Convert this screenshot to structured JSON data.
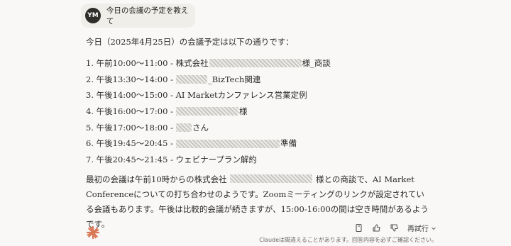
{
  "user_message": {
    "initials": "YM",
    "text": "今日の会議の予定を教えて"
  },
  "response": {
    "intro": "今日（2025年4月25日）の会議予定は以下の通りです：",
    "items": [
      {
        "num": "1.",
        "pre": "午前10:00～11:00 - 株式会社",
        "post": "様_商談"
      },
      {
        "num": "2.",
        "pre": "午後13:30～14:00 -",
        "post": "_BizTech関連"
      },
      {
        "num": "3.",
        "pre": "午後14:00～15:00 - AI Marketカンファレンス営業定例",
        "post": ""
      },
      {
        "num": "4.",
        "pre": "午後16:00～17:00 -",
        "post": "様"
      },
      {
        "num": "5.",
        "pre": "午後17:00～18:00 -",
        "post": "さん"
      },
      {
        "num": "6.",
        "pre": "午後19:45～20:45 -",
        "post": "準備"
      },
      {
        "num": "7.",
        "pre": "午後20:45～21:45 - ウェビナープラン解約",
        "post": ""
      }
    ],
    "summary_pre": "最初の会議は午前10時からの株式会社",
    "summary_post": "様との商談で、AI Market Conferenceについての打ち合わせのようです。Zoomミーティングのリンクが設定されている会議もあります。午後は比較的会議が続きますが、15:00-16:00の間は空き時間があるようです。"
  },
  "actions": {
    "copy_icon": "copy-icon",
    "thumbs_up_icon": "thumbs-up-icon",
    "thumbs_down_icon": "thumbs-down-icon",
    "retry_label": "再試行"
  },
  "disclaimer": "Claudeは間違えることがあります。回答内容を必ずご確認ください。",
  "colors": {
    "accent": "#d97757",
    "avatar_bg": "#2f2e2b",
    "bubble_bg": "#f0eee8"
  }
}
